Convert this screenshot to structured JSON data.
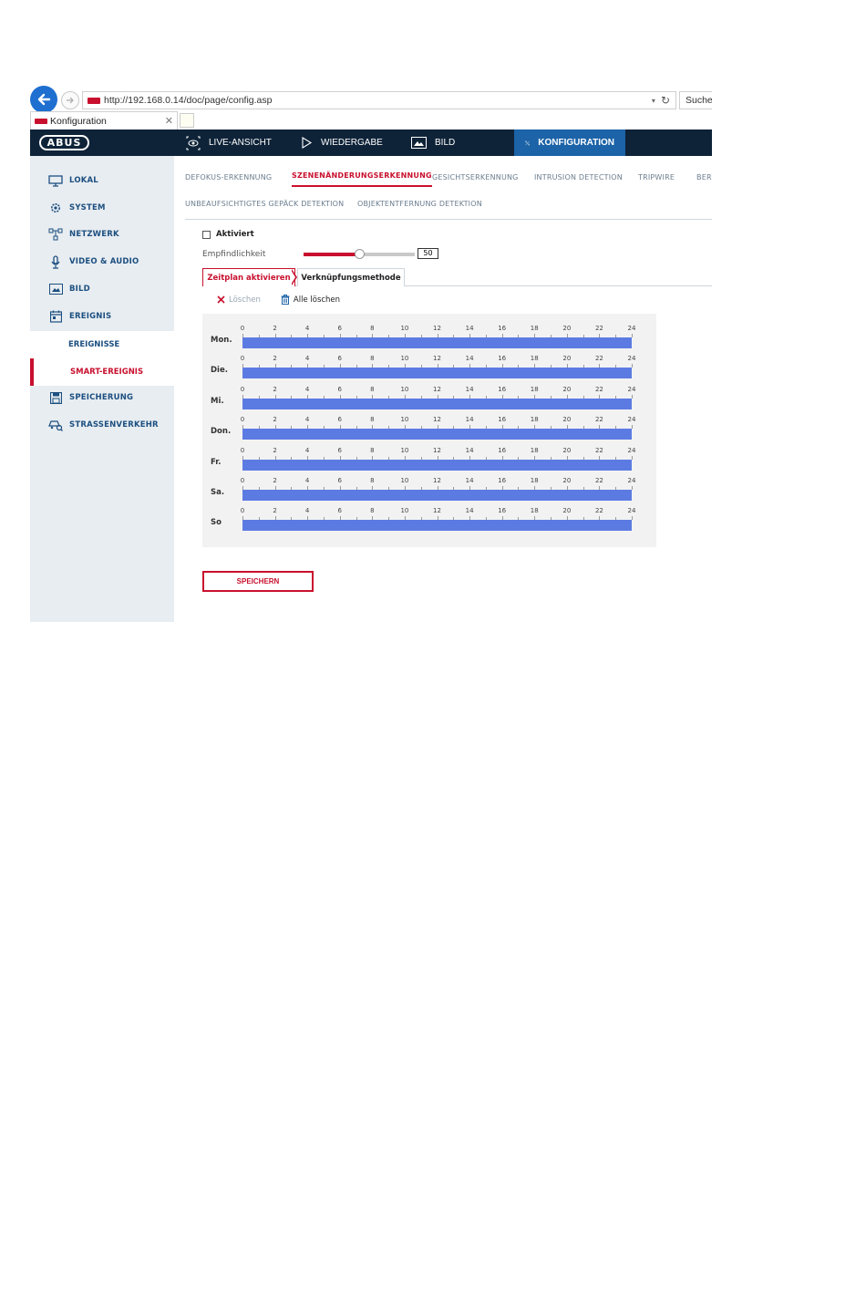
{
  "browser": {
    "url": "http://192.168.0.14/doc/page/config.asp",
    "search_placeholder": "Sucher",
    "tab_title": "Konfiguration"
  },
  "header": {
    "logo": "ABUS",
    "nav": [
      {
        "label": "Live-Ansicht",
        "icon": "eye-icon"
      },
      {
        "label": "Wiedergabe",
        "icon": "play-icon"
      },
      {
        "label": "Bild",
        "icon": "image-icon"
      },
      {
        "label": "Konfiguration",
        "icon": "tools-icon",
        "active": true
      }
    ]
  },
  "sidebar": {
    "items": [
      {
        "label": "Lokal",
        "icon": "monitor-icon"
      },
      {
        "label": "System",
        "icon": "gear-icon"
      },
      {
        "label": "Netzwerk",
        "icon": "network-icon"
      },
      {
        "label": "Video & Audio",
        "icon": "microphone-icon"
      },
      {
        "label": "Bild",
        "icon": "image-icon"
      },
      {
        "label": "Ereignis",
        "icon": "calendar-icon"
      }
    ],
    "sub_items": [
      {
        "label": "Ereignisse"
      },
      {
        "label": "Smart-Ereignis",
        "active": true
      }
    ],
    "items_after": [
      {
        "label": "Speicherung",
        "icon": "save-icon"
      },
      {
        "label": "Straßenverkehr",
        "icon": "car-search-icon"
      }
    ]
  },
  "subtabs": {
    "row1": [
      "Defokus-Erkennung",
      "Szenenänderungserkennung",
      "Gesichtserkennung",
      "Intrusion Detection",
      "Tripwire",
      "Ber"
    ],
    "row2": [
      "Unbeaufsichtigtes Gepäck Detektion",
      "Objektentfernung Detektion"
    ],
    "active": "Szenenänderungserkennung"
  },
  "form": {
    "enabled_label": "Aktiviert",
    "enabled_checked": false,
    "sensitivity_label": "Empfindlichkeit",
    "sensitivity_value": "50",
    "sensitivity_fraction": 0.5
  },
  "schedule_tabs": {
    "active": "Zeitplan aktivieren",
    "other": "Verknüpfungsmethode"
  },
  "toolbar": {
    "delete_label": "Löschen",
    "delete_all_label": "Alle löschen"
  },
  "schedule": {
    "hours": [
      "0",
      "2",
      "4",
      "6",
      "8",
      "10",
      "12",
      "14",
      "16",
      "18",
      "20",
      "22",
      "24"
    ],
    "days": [
      "Mon.",
      "Die.",
      "Mi.",
      "Don.",
      "Fr.",
      "Sa.",
      "So"
    ],
    "bar_color": "#5c7be2"
  },
  "save_label": "Speichern",
  "colors": {
    "accent": "#c8102e",
    "header_bg": "#0e2338",
    "active_nav": "#1c63a8",
    "sidebar_bg": "#e8edf1"
  }
}
